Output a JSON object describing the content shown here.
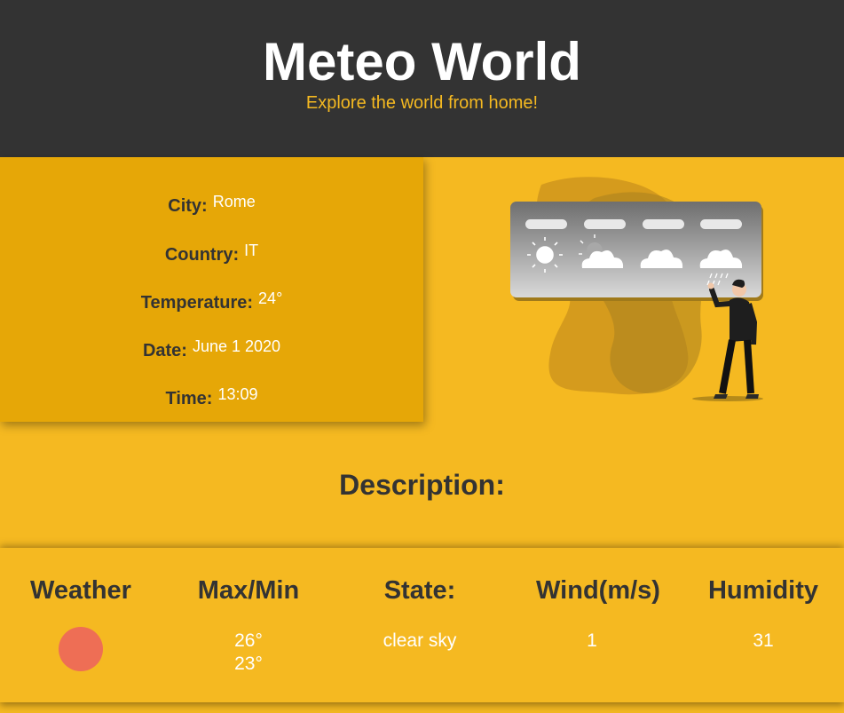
{
  "header": {
    "title": "Meteo World",
    "subtitle": "Explore the world from home!"
  },
  "info": {
    "city_label": "City:",
    "city": "Rome",
    "country_label": "Country:",
    "country": "IT",
    "temperature_label": "Temperature:",
    "temperature": "24°",
    "date_label": "Date:",
    "date": "June 1 2020",
    "time_label": "Time:",
    "time": "13:09"
  },
  "description": {
    "title": "Description:"
  },
  "table": {
    "headers": {
      "weather": "Weather",
      "maxmin": "Max/Min",
      "state": "State:",
      "wind": "Wind(m/s)",
      "humidity": "Humidity"
    },
    "values": {
      "weather_icon": "weather-circle-icon",
      "max": "26°",
      "min": "23°",
      "state": "clear sky",
      "wind": "1",
      "humidity": "31"
    }
  },
  "colors": {
    "header_bg": "#333333",
    "accent": "#f5b921",
    "card_bg": "#e6a707",
    "weather_dot": "#ee6e55"
  },
  "illustration": {
    "icons": [
      "sun-icon",
      "partly-cloudy-icon",
      "cloud-icon",
      "rain-icon"
    ]
  }
}
